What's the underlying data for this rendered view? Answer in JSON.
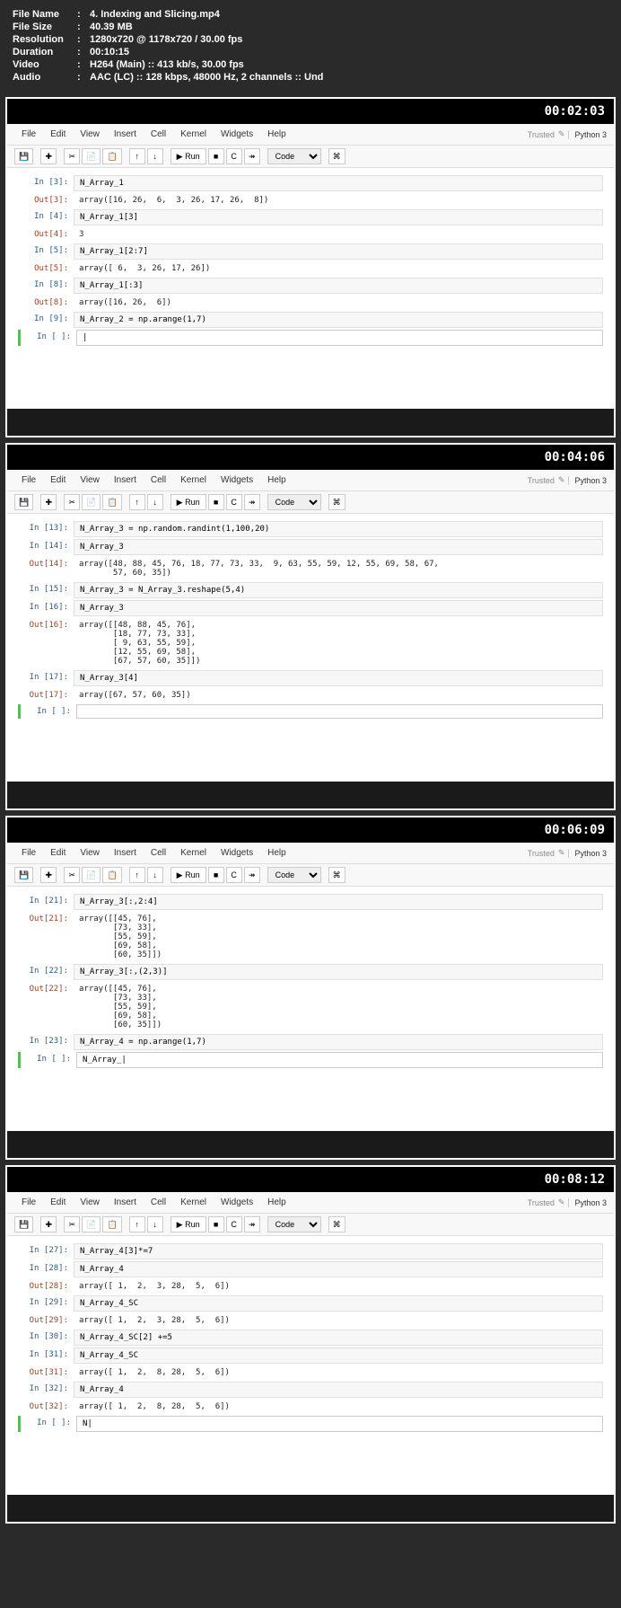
{
  "metadata": {
    "filename_label": "File Name",
    "filename": "4. Indexing and Slicing.mp4",
    "filesize_label": "File Size",
    "filesize": "40.39 MB",
    "resolution_label": "Resolution",
    "resolution": "1280x720 @ 1178x720 / 30.00 fps",
    "duration_label": "Duration",
    "duration": "00:10:15",
    "video_label": "Video",
    "video": "H264 (Main) :: 413 kb/s, 30.00 fps",
    "audio_label": "Audio",
    "audio": "AAC (LC) :: 128 kbps, 48000 Hz, 2 channels :: Und"
  },
  "menu": {
    "file": "File",
    "edit": "Edit",
    "view": "View",
    "insert": "Insert",
    "cell": "Cell",
    "kernel": "Kernel",
    "widgets": "Widgets",
    "help": "Help"
  },
  "header": {
    "trusted": "Trusted",
    "kernel": "Python 3"
  },
  "toolbar": {
    "save": "💾",
    "add": "✚",
    "cut": "✂",
    "copy": "📄",
    "paste": "📋",
    "up": "↑",
    "down": "↓",
    "run": "▶ Run",
    "stop": "■",
    "restart": "C",
    "forward": "↠",
    "celltype": "Code",
    "cmd": "⌘"
  },
  "frames": [
    {
      "timestamp": "00:02:03",
      "cells": [
        {
          "type": "in",
          "n": "3",
          "code": "N_Array_1"
        },
        {
          "type": "out",
          "n": "3",
          "code": "array([16, 26,  6,  3, 26, 17, 26,  8])"
        },
        {
          "type": "in",
          "n": "4",
          "code": "N_Array_1[3]"
        },
        {
          "type": "out",
          "n": "4",
          "code": "3"
        },
        {
          "type": "in",
          "n": "5",
          "code": "N_Array_1[2:7]"
        },
        {
          "type": "out",
          "n": "5",
          "code": "array([ 6,  3, 26, 17, 26])"
        },
        {
          "type": "in",
          "n": "8",
          "code": "N_Array_1[:3]"
        },
        {
          "type": "out",
          "n": "8",
          "code": "array([16, 26,  6])"
        },
        {
          "type": "in",
          "n": "9",
          "code": "N_Array_2 = np.arange(1,7)"
        },
        {
          "type": "active",
          "n": " ",
          "code": "|"
        }
      ]
    },
    {
      "timestamp": "00:04:06",
      "cells": [
        {
          "type": "in",
          "n": "13",
          "code": "N_Array_3 = np.random.randint(1,100,20)"
        },
        {
          "type": "in",
          "n": "14",
          "code": "N_Array_3"
        },
        {
          "type": "out",
          "n": "14",
          "code": "array([48, 88, 45, 76, 18, 77, 73, 33,  9, 63, 55, 59, 12, 55, 69, 58, 67,\n       57, 60, 35])"
        },
        {
          "type": "in",
          "n": "15",
          "code": "N_Array_3 = N_Array_3.reshape(5,4)"
        },
        {
          "type": "in",
          "n": "16",
          "code": "N_Array_3"
        },
        {
          "type": "out",
          "n": "16",
          "code": "array([[48, 88, 45, 76],\n       [18, 77, 73, 33],\n       [ 9, 63, 55, 59],\n       [12, 55, 69, 58],\n       [67, 57, 60, 35]])"
        },
        {
          "type": "in",
          "n": "17",
          "code": "N_Array_3[4]"
        },
        {
          "type": "out",
          "n": "17",
          "code": "array([67, 57, 60, 35])"
        },
        {
          "type": "active",
          "n": " ",
          "code": ""
        }
      ]
    },
    {
      "timestamp": "00:06:09",
      "cells": [
        {
          "type": "in",
          "n": "21",
          "code": "N_Array_3[:,2:4]"
        },
        {
          "type": "out",
          "n": "21",
          "code": "array([[45, 76],\n       [73, 33],\n       [55, 59],\n       [69, 58],\n       [60, 35]])"
        },
        {
          "type": "in",
          "n": "22",
          "code": "N_Array_3[:,(2,3)]"
        },
        {
          "type": "out",
          "n": "22",
          "code": "array([[45, 76],\n       [73, 33],\n       [55, 59],\n       [69, 58],\n       [60, 35]])"
        },
        {
          "type": "in",
          "n": "23",
          "code": "N_Array_4 = np.arange(1,7)"
        },
        {
          "type": "active",
          "n": " ",
          "code": "N_Array_|"
        }
      ]
    },
    {
      "timestamp": "00:08:12",
      "cells": [
        {
          "type": "in",
          "n": "27",
          "code": "N_Array_4[3]*=7"
        },
        {
          "type": "in",
          "n": "28",
          "code": "N_Array_4"
        },
        {
          "type": "out",
          "n": "28",
          "code": "array([ 1,  2,  3, 28,  5,  6])"
        },
        {
          "type": "in",
          "n": "29",
          "code": "N_Array_4_SC"
        },
        {
          "type": "out",
          "n": "29",
          "code": "array([ 1,  2,  3, 28,  5,  6])"
        },
        {
          "type": "in",
          "n": "30",
          "code": "N_Array_4_SC[2] +=5"
        },
        {
          "type": "in",
          "n": "31",
          "code": "N_Array_4_SC"
        },
        {
          "type": "out",
          "n": "31",
          "code": "array([ 1,  2,  8, 28,  5,  6])"
        },
        {
          "type": "in",
          "n": "32",
          "code": "N_Array_4"
        },
        {
          "type": "out",
          "n": "32",
          "code": "array([ 1,  2,  8, 28,  5,  6])"
        },
        {
          "type": "active",
          "n": " ",
          "code": "N|"
        }
      ]
    }
  ]
}
